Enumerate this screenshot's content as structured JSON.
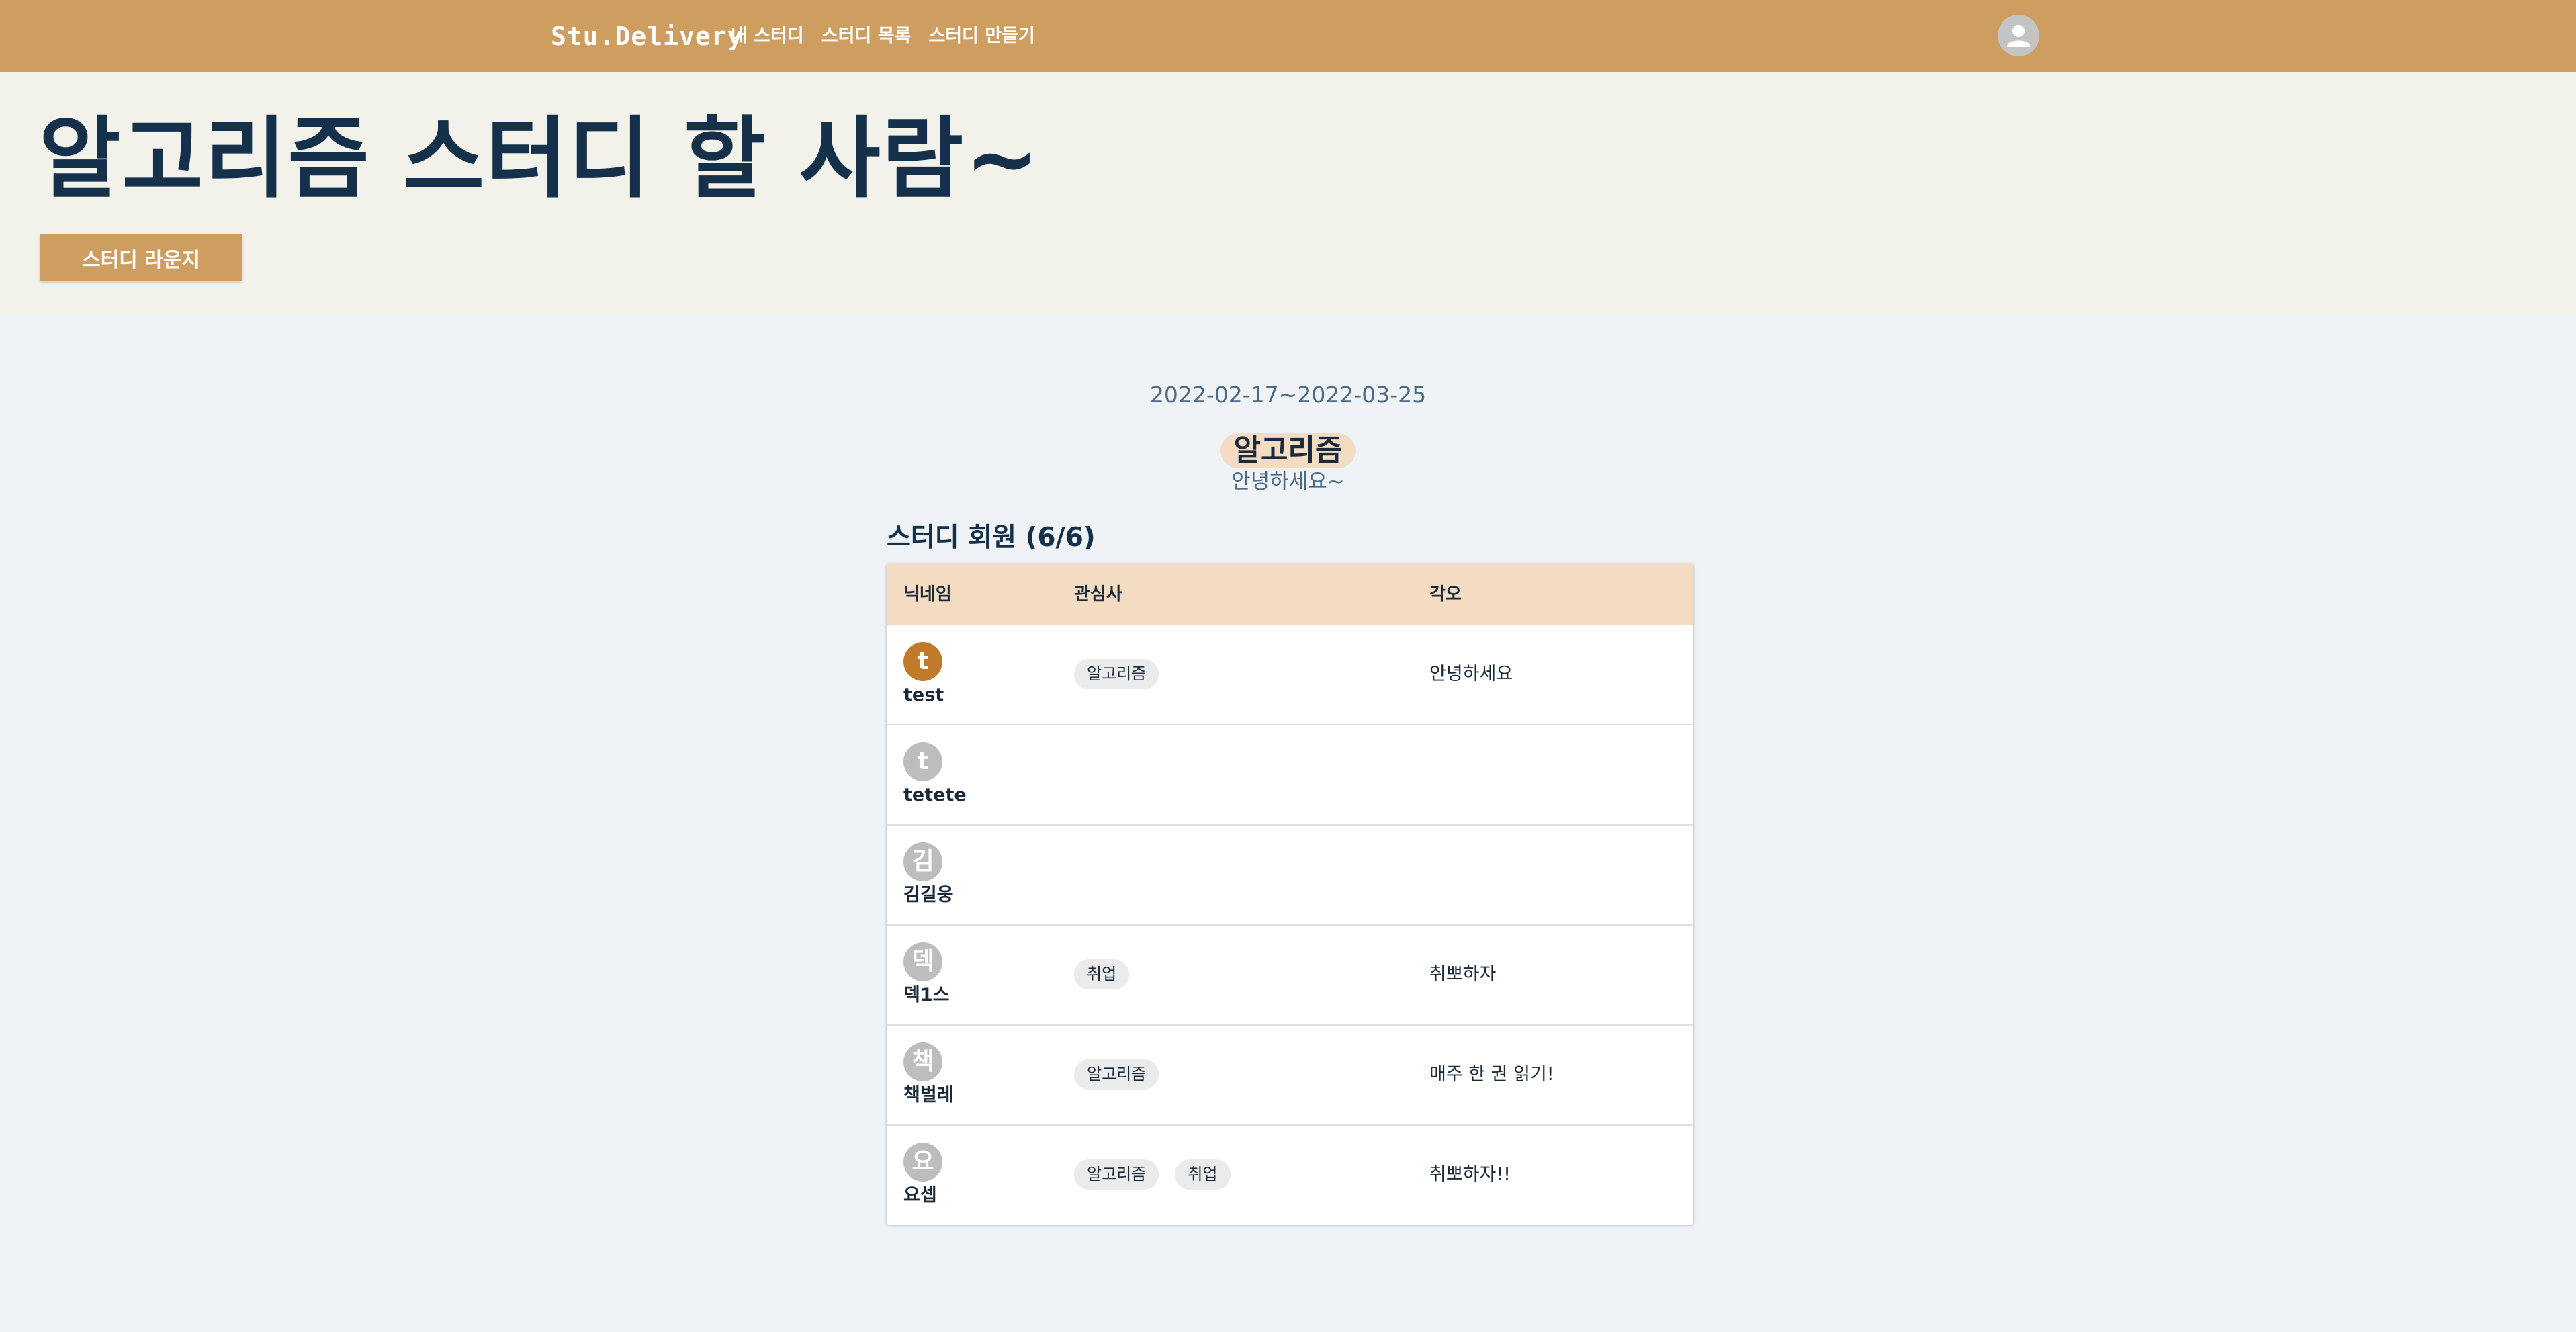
{
  "nav": {
    "brand": "Stu.Delivery",
    "links": [
      "내 스터디",
      "스터디 목록",
      "스터디 만들기"
    ],
    "account_icon": "account-circle-icon"
  },
  "hero": {
    "title": "알고리즘 스터디 할 사람~",
    "lounge_button": "스터디 라운지"
  },
  "study": {
    "period": "2022-02-17~2022-03-25",
    "topic": "알고리즘",
    "greeting": "안녕하세요~",
    "members_title": "스터디 회원 (6/6)"
  },
  "table": {
    "headers": [
      "닉네임",
      "관심사",
      "각오"
    ],
    "rows": [
      {
        "initial": "t",
        "nickname": "test",
        "interests": [
          "알고리즘"
        ],
        "resolution": "안녕하세요",
        "highlight": true
      },
      {
        "initial": "t",
        "nickname": "tetete",
        "interests": [],
        "resolution": "",
        "highlight": false
      },
      {
        "initial": "김",
        "nickname": "김길웅",
        "interests": [],
        "resolution": "",
        "highlight": false
      },
      {
        "initial": "덱",
        "nickname": "덱1스",
        "interests": [
          "취업"
        ],
        "resolution": "취뽀하자",
        "highlight": false
      },
      {
        "initial": "책",
        "nickname": "책벌레",
        "interests": [
          "알고리즘"
        ],
        "resolution": "매주 한 권 읽기!",
        "highlight": false
      },
      {
        "initial": "요",
        "nickname": "요셉",
        "interests": [
          "알고리즘",
          "취업"
        ],
        "resolution": "취뽀하자!!",
        "highlight": false
      }
    ]
  },
  "colors": {
    "header_bg": "#cd9e60",
    "hero_bg": "#f2f1ea",
    "page_bg": "#eff3f6",
    "table_head_bg": "#f4dcc2",
    "highlight_avatar": "#c07a2a",
    "default_avatar": "#bdbdbd"
  }
}
